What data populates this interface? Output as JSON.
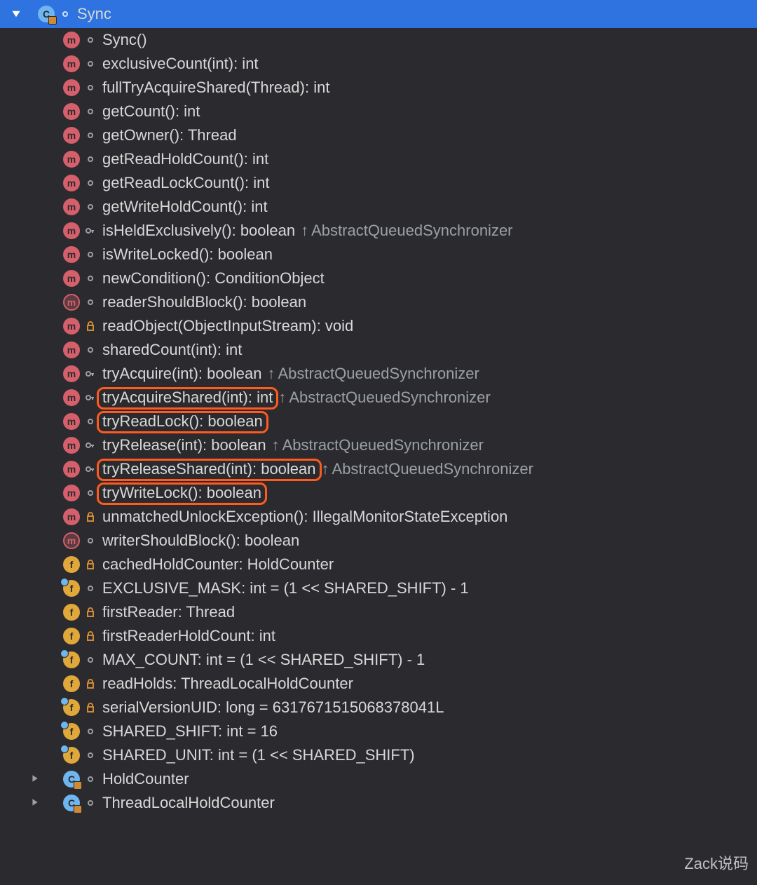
{
  "header": {
    "class_name": "Sync"
  },
  "members": [
    {
      "kind": "method",
      "vis": "pkg",
      "text": "Sync()"
    },
    {
      "kind": "method",
      "vis": "pkg",
      "text": "exclusiveCount(int): int"
    },
    {
      "kind": "method",
      "vis": "pkg",
      "text": "fullTryAcquireShared(Thread): int"
    },
    {
      "kind": "method",
      "vis": "pkg",
      "text": "getCount(): int"
    },
    {
      "kind": "method",
      "vis": "pkg",
      "text": "getOwner(): Thread"
    },
    {
      "kind": "method",
      "vis": "pkg",
      "text": "getReadHoldCount(): int"
    },
    {
      "kind": "method",
      "vis": "pkg",
      "text": "getReadLockCount(): int"
    },
    {
      "kind": "method",
      "vis": "pkg",
      "text": "getWriteHoldCount(): int"
    },
    {
      "kind": "method",
      "vis": "key",
      "text": "isHeldExclusively(): boolean",
      "over": "AbstractQueuedSynchronizer"
    },
    {
      "kind": "method",
      "vis": "pkg",
      "text": "isWriteLocked(): boolean"
    },
    {
      "kind": "method",
      "vis": "pkg",
      "text": "newCondition(): ConditionObject"
    },
    {
      "kind": "methodA",
      "vis": "pkg",
      "text": "readerShouldBlock(): boolean"
    },
    {
      "kind": "method",
      "vis": "priv",
      "text": "readObject(ObjectInputStream): void"
    },
    {
      "kind": "method",
      "vis": "pkg",
      "text": "sharedCount(int): int"
    },
    {
      "kind": "method",
      "vis": "key",
      "text": "tryAcquire(int): boolean",
      "over": "AbstractQueuedSynchronizer"
    },
    {
      "kind": "method",
      "vis": "key",
      "text": "tryAcquireShared(int): int",
      "over": "AbstractQueuedSynchronizer",
      "hl": true
    },
    {
      "kind": "method",
      "vis": "pkg",
      "text": "tryReadLock(): boolean",
      "hl": true
    },
    {
      "kind": "method",
      "vis": "key",
      "text": "tryRelease(int): boolean",
      "over": "AbstractQueuedSynchronizer"
    },
    {
      "kind": "method",
      "vis": "key",
      "text": "tryReleaseShared(int): boolean",
      "over": "AbstractQueuedSynchronizer",
      "hl": true
    },
    {
      "kind": "method",
      "vis": "pkg",
      "text": "tryWriteLock(): boolean",
      "hl": true
    },
    {
      "kind": "method",
      "vis": "priv",
      "text": "unmatchedUnlockException(): IllegalMonitorStateException"
    },
    {
      "kind": "methodA",
      "vis": "pkg",
      "text": "writerShouldBlock(): boolean"
    },
    {
      "kind": "field",
      "vis": "priv",
      "text": "cachedHoldCounter: HoldCounter"
    },
    {
      "kind": "fieldS",
      "vis": "pkg",
      "text": "EXCLUSIVE_MASK: int = (1 << SHARED_SHIFT) - 1"
    },
    {
      "kind": "field",
      "vis": "priv",
      "text": "firstReader: Thread"
    },
    {
      "kind": "field",
      "vis": "priv",
      "text": "firstReaderHoldCount: int"
    },
    {
      "kind": "fieldS",
      "vis": "pkg",
      "text": "MAX_COUNT: int = (1 << SHARED_SHIFT) - 1"
    },
    {
      "kind": "field",
      "vis": "priv",
      "text": "readHolds: ThreadLocalHoldCounter"
    },
    {
      "kind": "fieldS",
      "vis": "priv",
      "text": "serialVersionUID: long = 6317671515068378041L"
    },
    {
      "kind": "fieldS",
      "vis": "pkg",
      "text": "SHARED_SHIFT: int = 16"
    },
    {
      "kind": "fieldS",
      "vis": "pkg",
      "text": "SHARED_UNIT: int = (1 << SHARED_SHIFT)"
    }
  ],
  "inner_classes": [
    {
      "text": "HoldCounter"
    },
    {
      "text": "ThreadLocalHoldCounter"
    }
  ],
  "watermark": "Zack说码"
}
